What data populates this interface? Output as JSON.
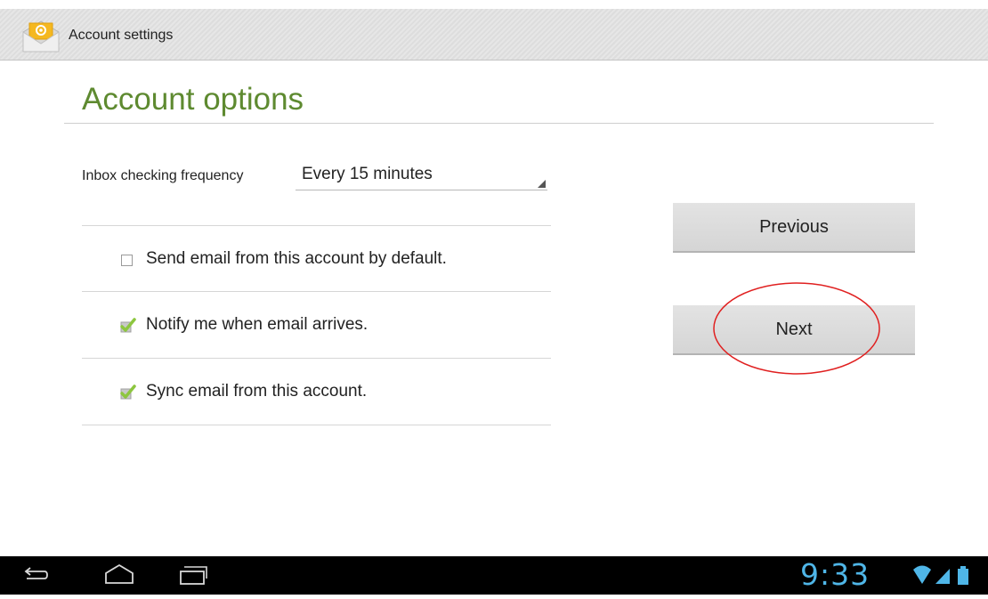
{
  "actionbar": {
    "title": "Account settings",
    "icon": "email-app-icon"
  },
  "page": {
    "title": "Account options"
  },
  "frequency": {
    "label": "Inbox checking frequency",
    "value": "Every 15 minutes"
  },
  "options": [
    {
      "label": "Send email from this account by default.",
      "checked": false
    },
    {
      "label": "Notify me when email arrives.",
      "checked": true
    },
    {
      "label": "Sync email from this account.",
      "checked": true
    }
  ],
  "buttons": {
    "previous": "Previous",
    "next": "Next"
  },
  "statusbar": {
    "time": "9:33",
    "icons": [
      "wifi-icon",
      "signal-icon",
      "battery-icon"
    ]
  },
  "navbar": {
    "icons": [
      "back-icon",
      "home-icon",
      "recent-apps-icon"
    ]
  },
  "colors": {
    "title_green": "#5e8a30",
    "check_green": "#8dc63f",
    "clock_blue": "#4fb6e8",
    "annotation_red": "#e02020"
  }
}
